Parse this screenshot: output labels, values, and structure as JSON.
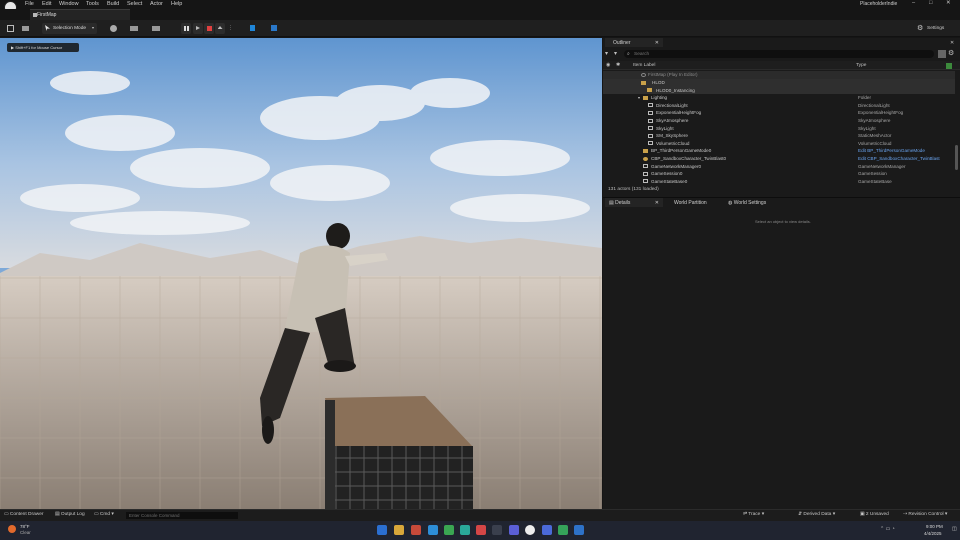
{
  "menu": {
    "items": [
      "File",
      "Edit",
      "Window",
      "Tools",
      "Build",
      "Select",
      "Actor",
      "Help"
    ],
    "project": "PlaceholderIndie"
  },
  "tabs": {
    "map": "FirstMap"
  },
  "toolbar": {
    "selection_mode": "Selection Mode",
    "settings": "Settings"
  },
  "viewport": {
    "hint": "Shift+F1 for Mouse Cursor"
  },
  "outliner": {
    "tab": "Outliner",
    "search_placeholder": "Search",
    "col_label": "Item Label",
    "col_type": "Type",
    "rows": [
      {
        "name": "FirstMap (Play In Editor)",
        "type": ""
      },
      {
        "name": "HLOD",
        "type": ""
      },
      {
        "name": "HLOD0_Instancing",
        "type": ""
      },
      {
        "name": "Lighting",
        "type": "Folder"
      },
      {
        "name": "DirectionalLight",
        "type": "DirectionalLight"
      },
      {
        "name": "ExponentialHeightFog",
        "type": "ExponentialHeightFog"
      },
      {
        "name": "SkyAtmosphere",
        "type": "SkyAtmosphere"
      },
      {
        "name": "SkyLight",
        "type": "SkyLight"
      },
      {
        "name": "SM_SkySphere",
        "type": "StaticMeshActor"
      },
      {
        "name": "VolumetricCloud",
        "type": "VolumetricCloud"
      },
      {
        "name": "BP_ThirdPersonGameMode0",
        "type": "Edit BP_ThirdPersonGameMode"
      },
      {
        "name": "CBP_SandboxCharacter_TwinBlast0",
        "type": "Edit CBP_SandboxCharacter_TwinBlast"
      },
      {
        "name": "GameNetworkManager0",
        "type": "GameNetworkManager"
      },
      {
        "name": "GameSession0",
        "type": "GameSession"
      },
      {
        "name": "GameStateBase0",
        "type": "GameStateBase"
      }
    ],
    "status": "131 actors (131 loaded)"
  },
  "details": {
    "tabs": [
      "Details",
      "World Partition",
      "World Settings"
    ],
    "empty": "Select an object to view details."
  },
  "bottombar": {
    "content_drawer": "Content Drawer",
    "output_log": "Output Log",
    "cmd": "Cmd",
    "console_placeholder": "Enter Console Command",
    "trace": "Trace",
    "derived": "Derived Data",
    "unsaved": "2 Unsaved",
    "revision": "Revision Control"
  },
  "taskbar": {
    "temp": "78°F",
    "weather": "Clear",
    "time": "9:00 PM",
    "date": "4/4/2025"
  },
  "colors": {
    "accent": "#1f86d9",
    "edit_link": "#6aa4f0",
    "folder": "#c9a14a"
  }
}
